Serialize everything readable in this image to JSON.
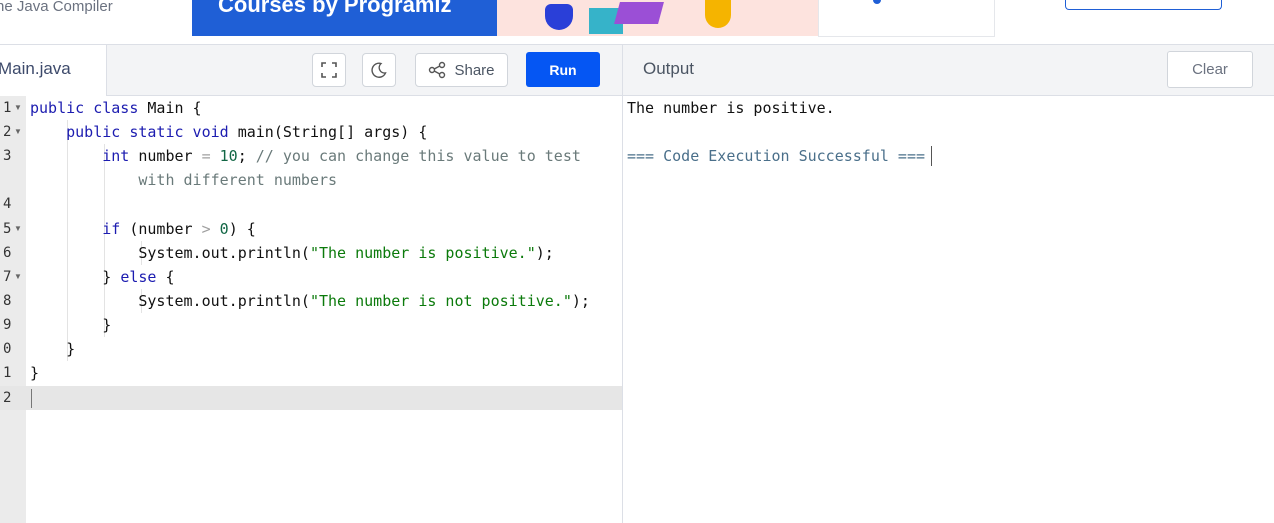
{
  "site": {
    "title": "ne Java Compiler"
  },
  "ad": {
    "headline": "Courses by Programiz"
  },
  "editor": {
    "file_tab": "Main.java",
    "share_label": "Share",
    "run_label": "Run",
    "line_numbers": [
      "1",
      "2",
      "3",
      "",
      "4",
      "5",
      "6",
      "7",
      "8",
      "9",
      "0",
      "1",
      "2"
    ]
  },
  "output": {
    "title": "Output",
    "clear_label": "Clear",
    "lines": [
      "The number is positive.",
      "",
      "=== Code Execution Successful ==="
    ]
  },
  "colors": {
    "run_button": "#0556f3",
    "keyword": "#1c1cb0",
    "string": "#0b7a0b",
    "comment": "#6a7a7a"
  }
}
